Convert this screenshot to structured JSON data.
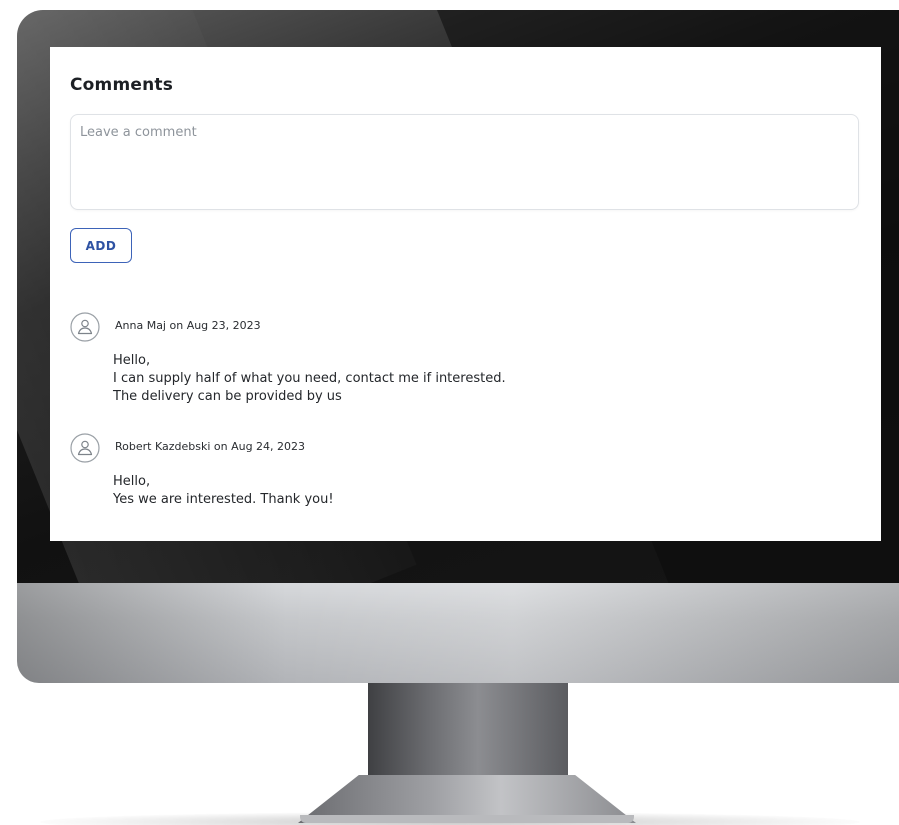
{
  "comments_panel": {
    "title": "Comments",
    "input_placeholder": "Leave a comment",
    "add_button_label": "ADD",
    "items": [
      {
        "author": "Anna Maj",
        "date": "Aug 23, 2023",
        "meta": "Anna Maj on Aug 23, 2023",
        "lines": [
          "Hello,",
          "I can supply half of what you need, contact me if interested.",
          "The delivery can be provided by us"
        ]
      },
      {
        "author": "Robert Kazdebski",
        "date": "Aug 24, 2023",
        "meta": "Robert Kazdebski on Aug 24, 2023",
        "lines": [
          "Hello,",
          "Yes we are interested. Thank you!"
        ]
      }
    ]
  },
  "icons": {
    "avatar": "user-icon"
  },
  "colors": {
    "accent": "#2e52a3",
    "border": "#dfe2e6",
    "placeholder": "#8e949b",
    "text": "#1c1f24"
  }
}
